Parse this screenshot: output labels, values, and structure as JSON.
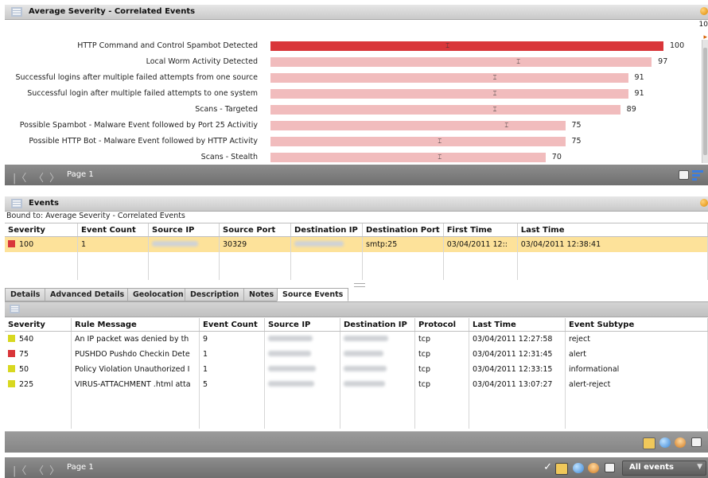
{
  "chart_panel": {
    "title": "Average Severity - Correlated Events",
    "corner_value": "10",
    "pager_label": "Page 1"
  },
  "chart_data": {
    "type": "bar",
    "orientation": "horizontal",
    "categories": [
      "HTTP Command and Control Spambot Detected",
      "Local Worm Activity Detected",
      "Successful logins after multiple failed attempts from one source",
      "Successful login after multiple failed attempts to one system",
      "Scans - Targeted",
      "Possible Spambot - Malware Event followed by Port 25 Activitiy",
      "Possible HTTP Bot - Malware Event followed by HTTP Activity",
      "Scans - Stealth"
    ],
    "values": [
      100,
      97,
      91,
      91,
      89,
      75,
      75,
      70
    ],
    "marker_values": [
      45,
      63,
      57,
      57,
      57,
      60,
      43,
      43
    ],
    "xlim": [
      0,
      100
    ],
    "highlight_color": "#d9363a",
    "bar_color": "#f1bcbd",
    "highlight_index": 0,
    "grid": false
  },
  "events_panel": {
    "title": "Events",
    "bound_text": "Bound to: Average Severity - Correlated Events",
    "columns": [
      "Severity",
      "Event Count",
      "Source IP",
      "Source Port",
      "Destination IP",
      "Destination Port",
      "First Time",
      "Last Time"
    ],
    "row": {
      "severity": "100",
      "severity_color": "#d9363a",
      "event_count": "1",
      "source_port": "30329",
      "destination_port": "smtp:25",
      "first_time": "03/04/2011 12::",
      "last_time": "03/04/2011 12:38:41"
    }
  },
  "detail_tabs": [
    "Details",
    "Advanced Details",
    "Geolocation",
    "Description",
    "Notes",
    "Source Events"
  ],
  "source_events": {
    "columns": [
      "Severity",
      "Rule Message",
      "Event Count",
      "Source IP",
      "Destination IP",
      "Protocol",
      "Last Time",
      "Event Subtype"
    ],
    "rows": [
      {
        "severity": "540",
        "color": "#d8d820",
        "rule": "An IP packet was denied by th",
        "count": "9",
        "protocol": "tcp",
        "last_time": "03/04/2011 12:27:58",
        "subtype": "reject"
      },
      {
        "severity": "75",
        "color": "#d9363a",
        "rule": "PUSHDO Pushdo Checkin Dete",
        "count": "1",
        "protocol": "tcp",
        "last_time": "03/04/2011 12:31:45",
        "subtype": "alert"
      },
      {
        "severity": "50",
        "color": "#d8d820",
        "rule": "Policy Violation  Unauthorized I",
        "count": "1",
        "protocol": "tcp",
        "last_time": "03/04/2011 12:33:15",
        "subtype": "informational"
      },
      {
        "severity": "225",
        "color": "#d8d820",
        "rule": "VIRUS-ATTACHMENT .html atta",
        "count": "5",
        "protocol": "tcp",
        "last_time": "03/04/2011 13:07:27",
        "subtype": "alert-reject"
      }
    ]
  },
  "bottom_bar": {
    "pager_label": "Page 1",
    "filter_value": "All events"
  }
}
